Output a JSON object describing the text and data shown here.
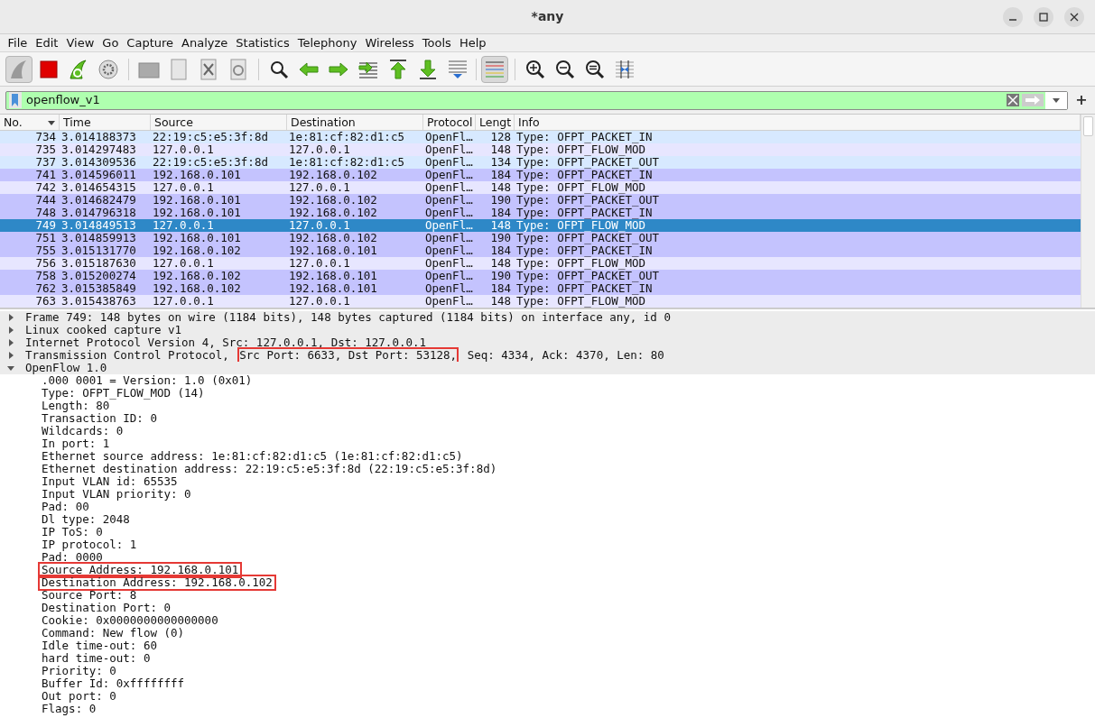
{
  "window": {
    "title": "*any"
  },
  "menu": [
    "File",
    "Edit",
    "View",
    "Go",
    "Capture",
    "Analyze",
    "Statistics",
    "Telephony",
    "Wireless",
    "Tools",
    "Help"
  ],
  "filter": {
    "value": "openflow_v1",
    "add_label": "+"
  },
  "packet_list": {
    "columns": [
      "No.",
      "Time",
      "Source",
      "Destination",
      "Protocol",
      "Lengt",
      "Info"
    ],
    "rows": [
      {
        "cells": [
          "734",
          "3.014188373",
          "22:19:c5:e5:3f:8d",
          "1e:81:cf:82:d1:c5",
          "OpenFl…",
          "128",
          "Type: OFPT_PACKET_IN"
        ],
        "color": "#d7e9ff",
        "selected": false
      },
      {
        "cells": [
          "735",
          "3.014297483",
          "127.0.0.1",
          "127.0.0.1",
          "OpenFl…",
          "148",
          "Type: OFPT_FLOW_MOD"
        ],
        "color": "#e7e6ff",
        "selected": false
      },
      {
        "cells": [
          "737",
          "3.014309536",
          "22:19:c5:e5:3f:8d",
          "1e:81:cf:82:d1:c5",
          "OpenFl…",
          "134",
          "Type: OFPT_PACKET_OUT"
        ],
        "color": "#d7e9ff",
        "selected": false
      },
      {
        "cells": [
          "741",
          "3.014596011",
          "192.168.0.101",
          "192.168.0.102",
          "OpenFl…",
          "184",
          "Type: OFPT_PACKET_IN"
        ],
        "color": "#c4c3fe",
        "selected": false
      },
      {
        "cells": [
          "742",
          "3.014654315",
          "127.0.0.1",
          "127.0.0.1",
          "OpenFl…",
          "148",
          "Type: OFPT_FLOW_MOD"
        ],
        "color": "#e7e6ff",
        "selected": false
      },
      {
        "cells": [
          "744",
          "3.014682479",
          "192.168.0.101",
          "192.168.0.102",
          "OpenFl…",
          "190",
          "Type: OFPT_PACKET_OUT"
        ],
        "color": "#c4c3fe",
        "selected": false
      },
      {
        "cells": [
          "748",
          "3.014796318",
          "192.168.0.101",
          "192.168.0.102",
          "OpenFl…",
          "184",
          "Type: OFPT_PACKET_IN"
        ],
        "color": "#c4c3fe",
        "selected": false
      },
      {
        "cells": [
          "749",
          "3.014849513",
          "127.0.0.1",
          "127.0.0.1",
          "OpenFl…",
          "148",
          "Type: OFPT_FLOW_MOD"
        ],
        "selected": true
      },
      {
        "cells": [
          "751",
          "3.014859913",
          "192.168.0.101",
          "192.168.0.102",
          "OpenFl…",
          "190",
          "Type: OFPT_PACKET_OUT"
        ],
        "color": "#c4c3fe",
        "selected": false
      },
      {
        "cells": [
          "755",
          "3.015131770",
          "192.168.0.102",
          "192.168.0.101",
          "OpenFl…",
          "184",
          "Type: OFPT_PACKET_IN"
        ],
        "color": "#c4c3fe",
        "selected": false
      },
      {
        "cells": [
          "756",
          "3.015187630",
          "127.0.0.1",
          "127.0.0.1",
          "OpenFl…",
          "148",
          "Type: OFPT_FLOW_MOD"
        ],
        "color": "#e7e6ff",
        "selected": false
      },
      {
        "cells": [
          "758",
          "3.015200274",
          "192.168.0.102",
          "192.168.0.101",
          "OpenFl…",
          "190",
          "Type: OFPT_PACKET_OUT"
        ],
        "color": "#c4c3fe",
        "selected": false
      },
      {
        "cells": [
          "762",
          "3.015385849",
          "192.168.0.102",
          "192.168.0.101",
          "OpenFl…",
          "184",
          "Type: OFPT_PACKET_IN"
        ],
        "color": "#c4c3fe",
        "selected": false
      },
      {
        "cells": [
          "763",
          "3.015438763",
          "127.0.0.1",
          "127.0.0.1",
          "OpenFl…",
          "148",
          "Type: OFPT_FLOW_MOD"
        ],
        "color": "#e7e6ff",
        "selected": false
      }
    ]
  },
  "details": [
    {
      "segments": [
        {
          "text": "Frame 749: 148 bytes on wire (1184 bits), 148 bytes captured (1184 bits) on interface any, id 0",
          "highlighted": false
        }
      ],
      "expanded": false
    },
    {
      "segments": [
        {
          "text": "Linux cooked capture v1",
          "highlighted": false
        }
      ],
      "expanded": false
    },
    {
      "segments": [
        {
          "text": "Internet Protocol Version 4, Src: 127.0.0.1, Dst: 127.0.0.1",
          "highlighted": false
        }
      ],
      "expanded": false
    },
    {
      "segments": [
        {
          "text": "Transmission Control Protocol, ",
          "highlighted": false
        },
        {
          "text": "Src Port: 6633, Dst Port: 53128,",
          "highlighted": true
        },
        {
          "text": " Seq: 4334, Ack: 4370, Len: 80",
          "highlighted": false
        }
      ],
      "expanded": false
    },
    {
      "segments": [
        {
          "text": "OpenFlow 1.0",
          "highlighted": false
        }
      ],
      "expanded": true,
      "children": [
        {
          "text": ".000 0001 = Version: 1.0 (0x01)",
          "highlighted": false
        },
        {
          "text": "Type: OFPT_FLOW_MOD (14)",
          "highlighted": false
        },
        {
          "text": "Length: 80",
          "highlighted": false
        },
        {
          "text": "Transaction ID: 0",
          "highlighted": false
        },
        {
          "text": "Wildcards: 0",
          "highlighted": false
        },
        {
          "text": "In port: 1",
          "highlighted": false
        },
        {
          "text": "Ethernet source address: 1e:81:cf:82:d1:c5 (1e:81:cf:82:d1:c5)",
          "highlighted": false
        },
        {
          "text": "Ethernet destination address: 22:19:c5:e5:3f:8d (22:19:c5:e5:3f:8d)",
          "highlighted": false
        },
        {
          "text": "Input VLAN id: 65535",
          "highlighted": false
        },
        {
          "text": "Input VLAN priority: 0",
          "highlighted": false
        },
        {
          "text": "Pad: 00",
          "highlighted": false
        },
        {
          "text": "Dl type: 2048",
          "highlighted": false
        },
        {
          "text": "IP ToS: 0",
          "highlighted": false
        },
        {
          "text": "IP protocol: 1",
          "highlighted": false
        },
        {
          "text": "Pad: 0000",
          "highlighted": false
        },
        {
          "text": "Source Address: 192.168.0.101",
          "highlighted": true
        },
        {
          "text": "Destination Address: 192.168.0.102",
          "highlighted": true
        },
        {
          "text": "Source Port: 8",
          "highlighted": false
        },
        {
          "text": "Destination Port: 0",
          "highlighted": false
        },
        {
          "text": "Cookie: 0x0000000000000000",
          "highlighted": false
        },
        {
          "text": "Command: New flow (0)",
          "highlighted": false
        },
        {
          "text": "Idle time-out: 60",
          "highlighted": false
        },
        {
          "text": "hard time-out: 0",
          "highlighted": false
        },
        {
          "text": "Priority: 0",
          "highlighted": false
        },
        {
          "text": "Buffer Id: 0xffffffff",
          "highlighted": false
        },
        {
          "text": "Out port: 0",
          "highlighted": false
        },
        {
          "text": "Flags: 0",
          "highlighted": false
        }
      ]
    }
  ]
}
